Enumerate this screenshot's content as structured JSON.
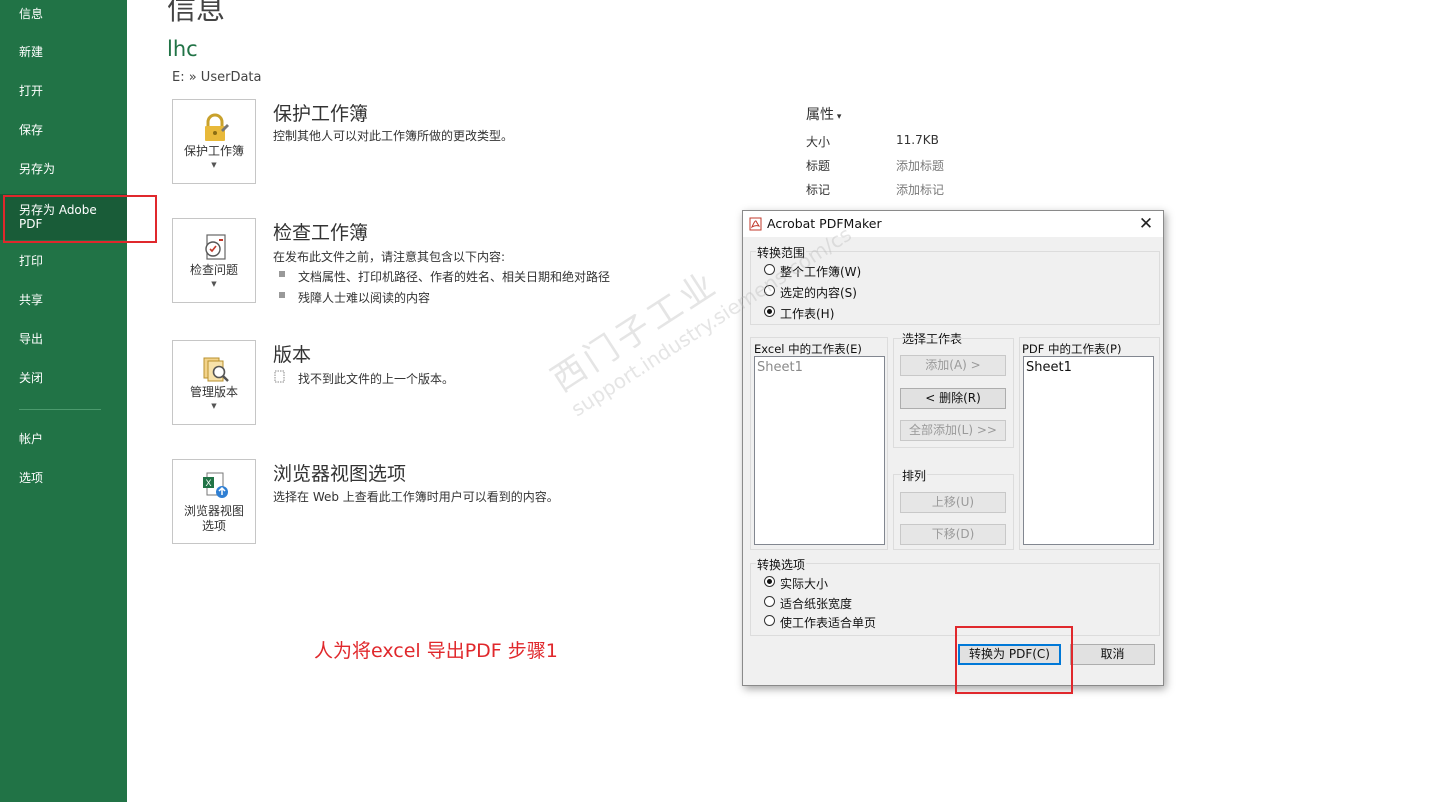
{
  "sidebar": {
    "items": [
      {
        "label": "信息"
      },
      {
        "label": "新建"
      },
      {
        "label": "打开"
      },
      {
        "label": "保存"
      },
      {
        "label": "另存为"
      },
      {
        "label": "另存为 Adobe PDF"
      },
      {
        "label": "打印"
      },
      {
        "label": "共享"
      },
      {
        "label": "导出"
      },
      {
        "label": "关闭"
      },
      {
        "label": "帐户"
      },
      {
        "label": "选项"
      }
    ]
  },
  "main": {
    "title": "信息",
    "user": "lhc",
    "path": "E: » UserData",
    "sections": [
      {
        "button": "保护工作簿",
        "title": "保护工作簿",
        "desc": "控制其他人可以对此工作簿所做的更改类型。"
      },
      {
        "button": "检查问题",
        "title": "检查工作簿",
        "desc": "在发布此文件之前，请注意其包含以下内容:",
        "bullets": [
          "文档属性、打印机路径、作者的姓名、相关日期和绝对路径",
          "残障人士难以阅读的内容"
        ]
      },
      {
        "button": "管理版本",
        "title": "版本",
        "desc": "找不到此文件的上一个版本。"
      },
      {
        "button_line1": "浏览器视图",
        "button_line2": "选项",
        "title": "浏览器视图选项",
        "desc": "选择在 Web 上查看此工作簿时用户可以看到的内容。"
      }
    ]
  },
  "properties": {
    "header": "属性",
    "rows": [
      {
        "label": "大小",
        "value": "11.7KB"
      },
      {
        "label": "标题",
        "value": "添加标题"
      },
      {
        "label": "标记",
        "value": "添加标记"
      }
    ]
  },
  "annotation": "人为将excel 导出PDF 步骤1",
  "dialog": {
    "title": "Acrobat PDFMaker",
    "range_label": "转换范围",
    "range_options": [
      "整个工作簿(W)",
      "选定的内容(S)",
      "工作表(H)"
    ],
    "select_label": "选择工作表",
    "excel_list_label": "Excel 中的工作表(E)",
    "excel_list_items": [
      "Sheet1"
    ],
    "pdf_list_label": "PDF 中的工作表(P)",
    "pdf_list_items": [
      "Sheet1"
    ],
    "add_button": "添加(A) >",
    "remove_button": "< 删除(R)",
    "add_all_button": "全部添加(L) >>",
    "order_label": "排列",
    "up_button": "上移(U)",
    "down_button": "下移(D)",
    "convert_label": "转换选项",
    "convert_options": [
      "实际大小",
      "适合纸张宽度",
      "使工作表适合单页"
    ],
    "convert_button": "转换为 PDF(C)",
    "cancel_button": "取消"
  },
  "watermark": {
    "line1": "西门子工业",
    "line2": "support.industry.siemens.com/cs"
  },
  "colors": {
    "sidebar": "#217346",
    "accent": "#217346",
    "highlight": "#e0282c"
  }
}
